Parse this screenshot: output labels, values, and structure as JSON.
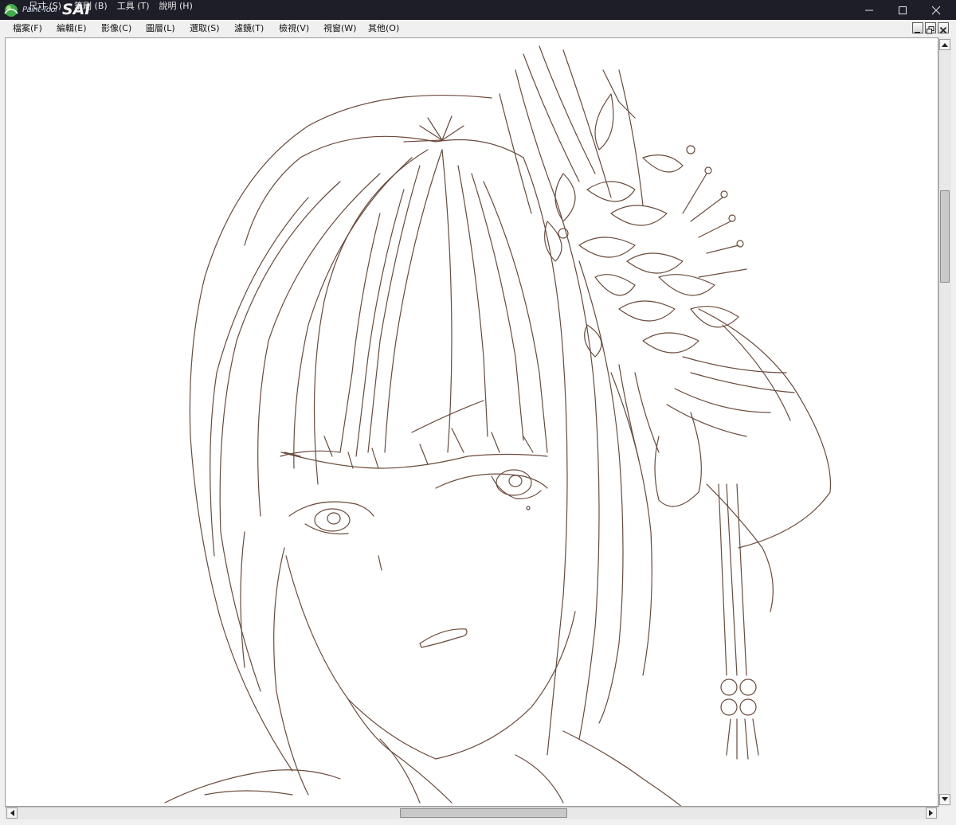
{
  "titlebar": {
    "logo_small": "Paint Tool",
    "logo_big": "SAI",
    "menus": [
      "尺寸 (S)",
      "筆刷 (B)",
      "工具 (T)",
      "說明 (H)"
    ],
    "minimize_glyph": "—",
    "maximize_glyph": "☐",
    "close_glyph": "✕"
  },
  "menubar": {
    "items": [
      "檔案(F)",
      "編輯(E)",
      "影像(C)",
      "圖層(L)",
      "選取(S)",
      "濾鏡(T)",
      "檢視(V)",
      "視窗(W)",
      "其他(O)"
    ]
  },
  "colors": {
    "titlebar_bg": "#1e1e28",
    "line_art": "#6b4a3a",
    "canvas_bg": "#ffffff",
    "chrome_bg": "#f0f0f0"
  },
  "icons": {
    "mdi_minimize": "minimize-icon",
    "mdi_restore": "restore-icon",
    "mdi_close": "close-icon"
  }
}
